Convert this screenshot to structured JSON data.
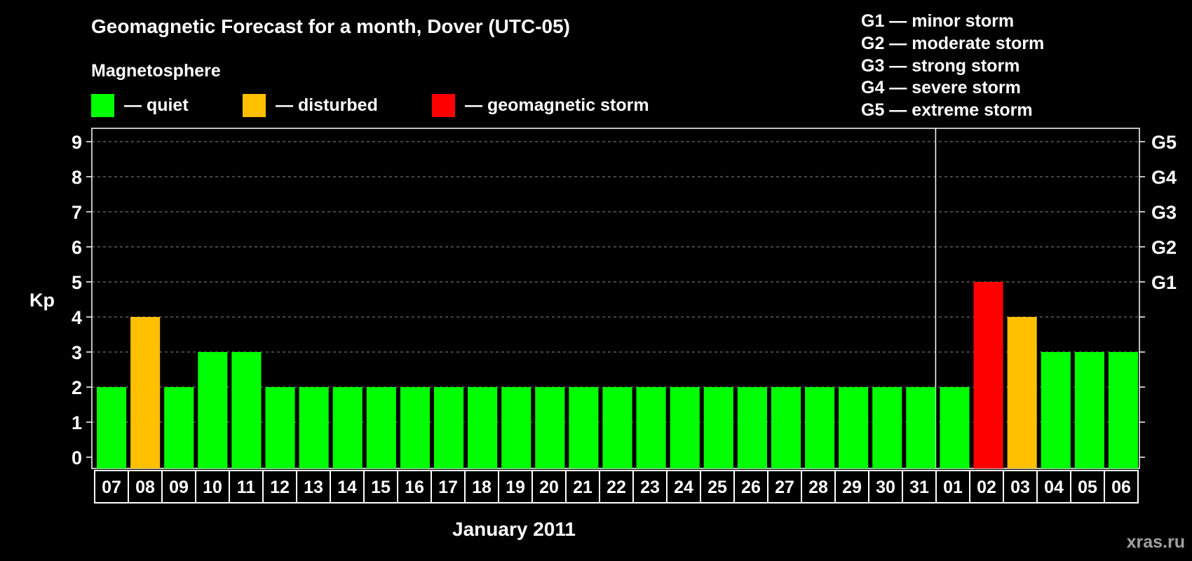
{
  "title": "Geomagnetic Forecast for a month, Dover (UTC-05)",
  "legend": {
    "heading": "Magnetosphere",
    "items": [
      {
        "key": "quiet",
        "label": "— quiet",
        "color": "#00ff00"
      },
      {
        "key": "disturbed",
        "label": "— disturbed",
        "color": "#ffc000"
      },
      {
        "key": "storm",
        "label": "— geomagnetic storm",
        "color": "#ff0000"
      }
    ]
  },
  "storm_scale": [
    "G1 — minor storm",
    "G2 — moderate storm",
    "G3 — strong storm",
    "G4 — severe storm",
    "G5 — extreme storm"
  ],
  "watermark": "xras.ru",
  "chart_data": {
    "type": "bar",
    "ylabel": "Kp",
    "xlabel": "January 2011",
    "ylim": [
      0,
      9
    ],
    "yticks": [
      "0",
      "1",
      "2",
      "3",
      "4",
      "5",
      "6",
      "7",
      "8",
      "9"
    ],
    "right_axis_labels": [
      {
        "kp": 5,
        "label": "G1"
      },
      {
        "kp": 6,
        "label": "G2"
      },
      {
        "kp": 7,
        "label": "G3"
      },
      {
        "kp": 8,
        "label": "G4"
      },
      {
        "kp": 9,
        "label": "G5"
      }
    ],
    "grid": "dashed horizontal",
    "month_divider_after": "31",
    "categories": [
      "07",
      "08",
      "09",
      "10",
      "11",
      "12",
      "13",
      "14",
      "15",
      "16",
      "17",
      "18",
      "19",
      "20",
      "21",
      "22",
      "23",
      "24",
      "25",
      "26",
      "27",
      "28",
      "29",
      "30",
      "31",
      "01",
      "02",
      "03",
      "04",
      "05",
      "06"
    ],
    "values": [
      2,
      4,
      2,
      3,
      3,
      2,
      2,
      2,
      2,
      2,
      2,
      2,
      2,
      2,
      2,
      2,
      2,
      2,
      2,
      2,
      2,
      2,
      2,
      2,
      2,
      2,
      5,
      4,
      3,
      3,
      3
    ],
    "status": [
      "quiet",
      "disturbed",
      "quiet",
      "quiet",
      "quiet",
      "quiet",
      "quiet",
      "quiet",
      "quiet",
      "quiet",
      "quiet",
      "quiet",
      "quiet",
      "quiet",
      "quiet",
      "quiet",
      "quiet",
      "quiet",
      "quiet",
      "quiet",
      "quiet",
      "quiet",
      "quiet",
      "quiet",
      "quiet",
      "quiet",
      "storm",
      "disturbed",
      "quiet",
      "quiet",
      "quiet"
    ]
  }
}
